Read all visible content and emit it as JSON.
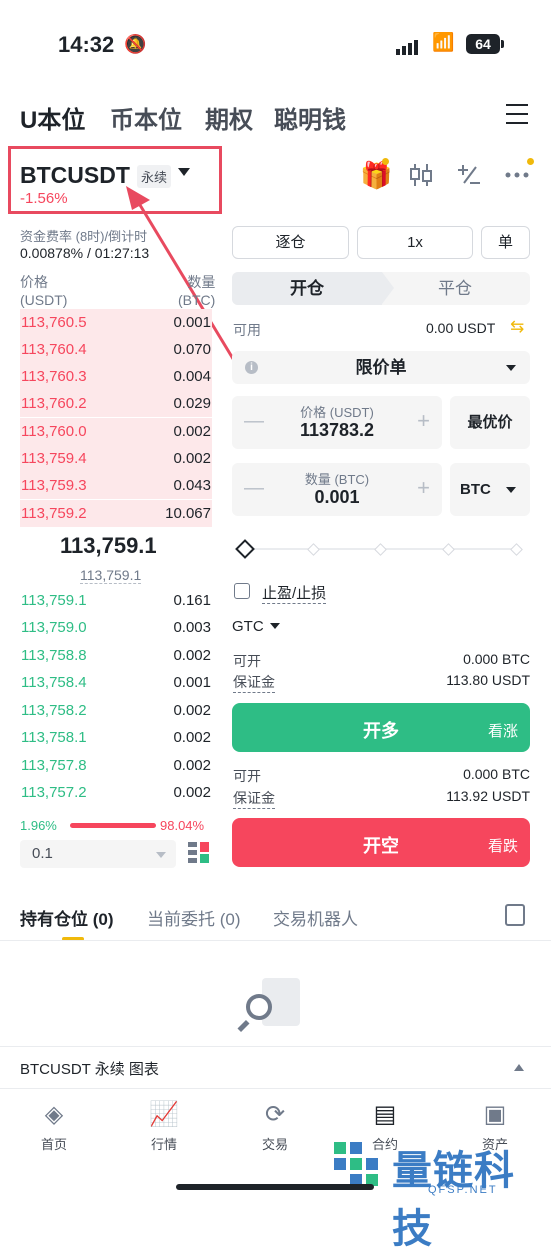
{
  "status_bar": {
    "time": "14:32",
    "battery": "64"
  },
  "top_tabs": [
    "U本位",
    "币本位",
    "期权",
    "聪明钱"
  ],
  "symbol": {
    "name": "BTCUSDT",
    "tag": "永续",
    "change": "-1.56%"
  },
  "funding": {
    "label": "资金费率 (8时)/倒计时",
    "value": "0.00878% / 01:27:13"
  },
  "orderbook": {
    "price_label": "价格",
    "price_unit": "(USDT)",
    "qty_label": "数量",
    "qty_unit": "(BTC)",
    "asks": [
      {
        "price": "113,760.5",
        "amount": "0.001"
      },
      {
        "price": "113,760.4",
        "amount": "0.070"
      },
      {
        "price": "113,760.3",
        "amount": "0.004"
      },
      {
        "price": "113,760.2",
        "amount": "0.029"
      },
      {
        "price": "113,760.0",
        "amount": "0.002"
      },
      {
        "price": "113,759.4",
        "amount": "0.002"
      },
      {
        "price": "113,759.3",
        "amount": "0.043"
      },
      {
        "price": "113,759.2",
        "amount": "10.067"
      }
    ],
    "last_price": "113,759.1",
    "mark_price": "113,759.1",
    "bids": [
      {
        "price": "113,759.1",
        "amount": "0.161"
      },
      {
        "price": "113,759.0",
        "amount": "0.003"
      },
      {
        "price": "113,758.8",
        "amount": "0.002"
      },
      {
        "price": "113,758.4",
        "amount": "0.001"
      },
      {
        "price": "113,758.2",
        "amount": "0.002"
      },
      {
        "price": "113,758.1",
        "amount": "0.002"
      },
      {
        "price": "113,757.8",
        "amount": "0.002"
      },
      {
        "price": "113,757.2",
        "amount": "0.002"
      }
    ],
    "buy_ratio": "1.96%",
    "sell_ratio": "98.04%",
    "depth": "0.1"
  },
  "order_form": {
    "margin_mode": "逐仓",
    "leverage": "1x",
    "position_mode": "单",
    "open_tab": "开仓",
    "close_tab": "平仓",
    "available_label": "可用",
    "available_value": "0.00 USDT",
    "order_type": "限价单",
    "price_label": "价格 (USDT)",
    "price_value": "113783.2",
    "best_price": "最优价",
    "qty_label": "数量 (BTC)",
    "qty_value": "0.001",
    "qty_unit": "BTC",
    "tpsl_label": "止盈/止损",
    "tif": "GTC",
    "long": {
      "max_label": "可开",
      "max_value": "0.000 BTC",
      "margin_label": "保证金",
      "margin_value": "113.80 USDT",
      "button": "开多",
      "sub": "看涨"
    },
    "short": {
      "max_label": "可开",
      "max_value": "0.000 BTC",
      "margin_label": "保证金",
      "margin_value": "113.92 USDT",
      "button": "开空",
      "sub": "看跌"
    }
  },
  "positions_tabs": [
    "持有仓位 (0)",
    "当前委托 (0)",
    "交易机器人"
  ],
  "chart_bar": "BTCUSDT 永续  图表",
  "bottom_nav": [
    "首页",
    "行情",
    "交易",
    "合约",
    "资产"
  ],
  "watermark": {
    "title": "量链科技",
    "sub": "QFSP.NET"
  },
  "colors": {
    "up": "#2ebd85",
    "down": "#f6465d",
    "accent": "#f0b90b",
    "highlight": "#e84a5f"
  }
}
